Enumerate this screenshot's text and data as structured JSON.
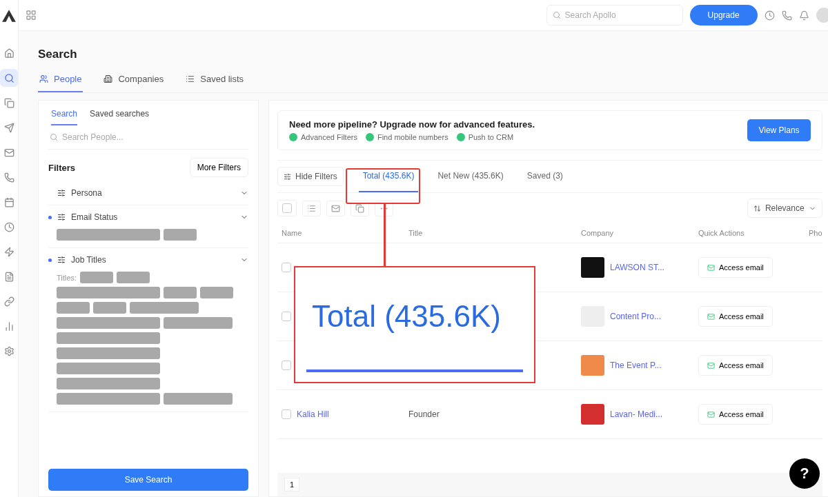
{
  "rail_items": [
    {
      "selected": false
    },
    {
      "selected": true
    },
    {
      "selected": false
    },
    {
      "selected": false
    },
    {
      "selected": false
    },
    {
      "selected": false
    },
    {
      "selected": false
    },
    {
      "selected": false
    },
    {
      "selected": false
    },
    {
      "selected": false
    },
    {
      "selected": false
    },
    {
      "selected": false
    },
    {
      "selected": false
    }
  ],
  "topbar": {
    "search_placeholder": "Search Apollo",
    "upgrade": "Upgrade"
  },
  "page_title": "Search",
  "tabs": [
    {
      "label": "People",
      "selected": true
    },
    {
      "label": "Companies",
      "selected": false
    },
    {
      "label": "Saved lists",
      "selected": false
    }
  ],
  "filter_panel": {
    "subtabs": [
      {
        "label": "Search",
        "selected": true
      },
      {
        "label": "Saved searches",
        "selected": false
      }
    ],
    "search_placeholder": "Search People...",
    "title": "Filters",
    "more_filters": "More Filters",
    "sections": [
      {
        "label": "Persona",
        "active": false
      },
      {
        "label": "Email Status",
        "active": true,
        "chips": [
          {
            "kind": "wide"
          },
          {
            "kind": "short"
          }
        ]
      },
      {
        "label": "Job Titles",
        "active": true,
        "prefix": "Titles:",
        "chips": [
          {
            "kind": "short"
          },
          {
            "kind": "short"
          },
          {
            "kind": "wide"
          },
          {
            "kind": "short"
          },
          {
            "kind": "short"
          },
          {
            "kind": "short"
          },
          {
            "kind": "short"
          },
          {
            "kind": "mid"
          },
          {
            "kind": "wide"
          },
          {
            "kind": "mid"
          },
          {
            "kind": "wide"
          },
          {
            "kind": "wide"
          },
          {
            "kind": "wide"
          },
          {
            "kind": "wide"
          },
          {
            "kind": "wide"
          },
          {
            "kind": "mid"
          }
        ]
      }
    ],
    "save": "Save Search"
  },
  "banner": {
    "title": "Need more pipeline? Upgrade now for advanced features.",
    "features": [
      "Advanced Filters",
      "Find mobile numbers",
      "Push to CRM"
    ],
    "button": "View Plans"
  },
  "hide_filters": "Hide Filters",
  "view_tabs": [
    {
      "label": "Total (435.6K)",
      "selected": true
    },
    {
      "label": "Net New (435.6K)",
      "selected": false
    },
    {
      "label": "Saved (3)",
      "selected": false
    }
  ],
  "sort": "Relevance",
  "columns": [
    "Name",
    "Title",
    "Company",
    "Quick Actions",
    "Pho"
  ],
  "rows": [
    {
      "checked": false,
      "company": "LAWSON ST...",
      "action": "Access email",
      "color": "#111111"
    },
    {
      "checked": false,
      "company": "Content Pro...",
      "action": "Access email",
      "color": "#eeeeee"
    },
    {
      "checked": false,
      "company": "The Event P...",
      "action": "Access email",
      "color": "#f08a4b"
    },
    {
      "checked": false,
      "name": "Kalia Hill",
      "title": "Founder",
      "company": "Lavan- Medi...",
      "action": "Access email",
      "color": "#d32f2f"
    }
  ],
  "page": "1",
  "callout": {
    "text": "Total (435.6K)"
  },
  "help": "?"
}
